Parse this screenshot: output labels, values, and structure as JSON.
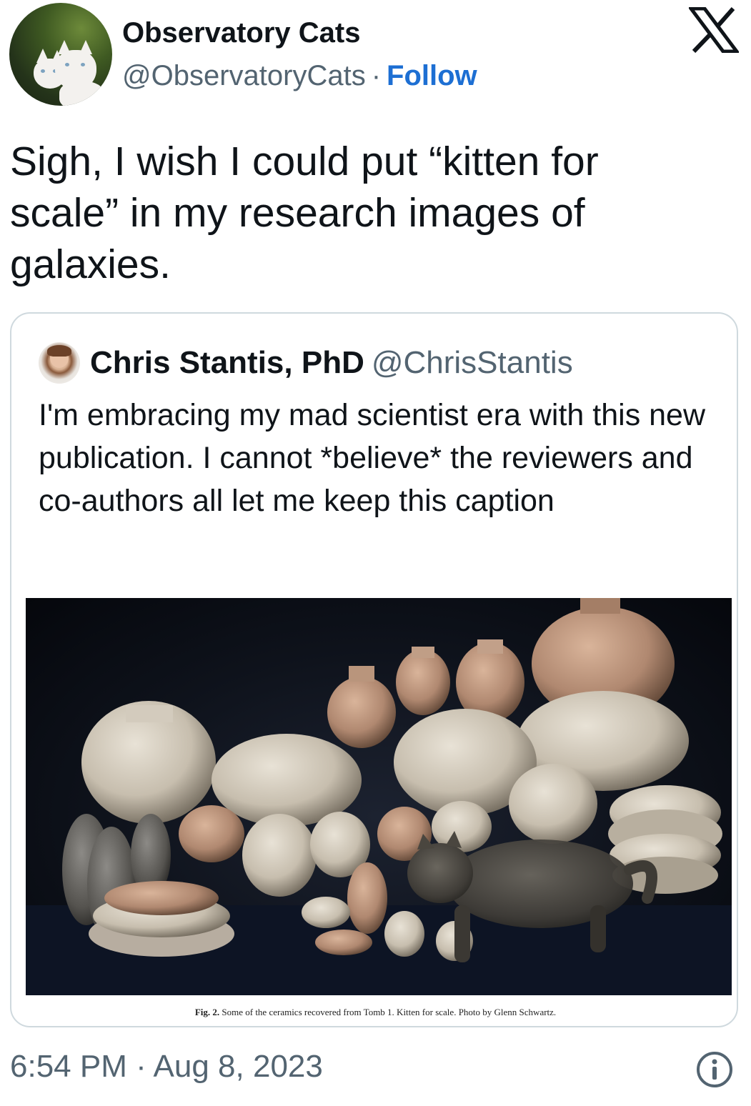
{
  "author": {
    "display_name": "Observatory Cats",
    "handle": "@ObservatoryCats",
    "separator": "·",
    "follow_label": "Follow",
    "avatar_icon": "kittens-avatar"
  },
  "brand": {
    "logo_icon": "x-logo-icon"
  },
  "tweet": {
    "text": "Sigh, I wish I could put “kitten for scale” in my research images of galaxies."
  },
  "quoted_tweet": {
    "display_name": "Chris Stantis, PhD",
    "handle": "@ChrisStantis",
    "text": "I'm embracing my mad scientist era with this new publication. I cannot *believe* the reviewers and co-authors all let me keep this caption",
    "caption_fig": "Fig. 2.",
    "caption_text": "Some of the ceramics recovered from Tomb 1. Kitten for scale. Photo by Glenn Schwartz."
  },
  "footer": {
    "timestamp": "6:54 PM · Aug 8, 2023",
    "info_icon": "info-icon"
  },
  "colors": {
    "follow": "#1d6fd3",
    "muted": "#536471",
    "text": "#0f1419",
    "border": "#cfd9de"
  }
}
